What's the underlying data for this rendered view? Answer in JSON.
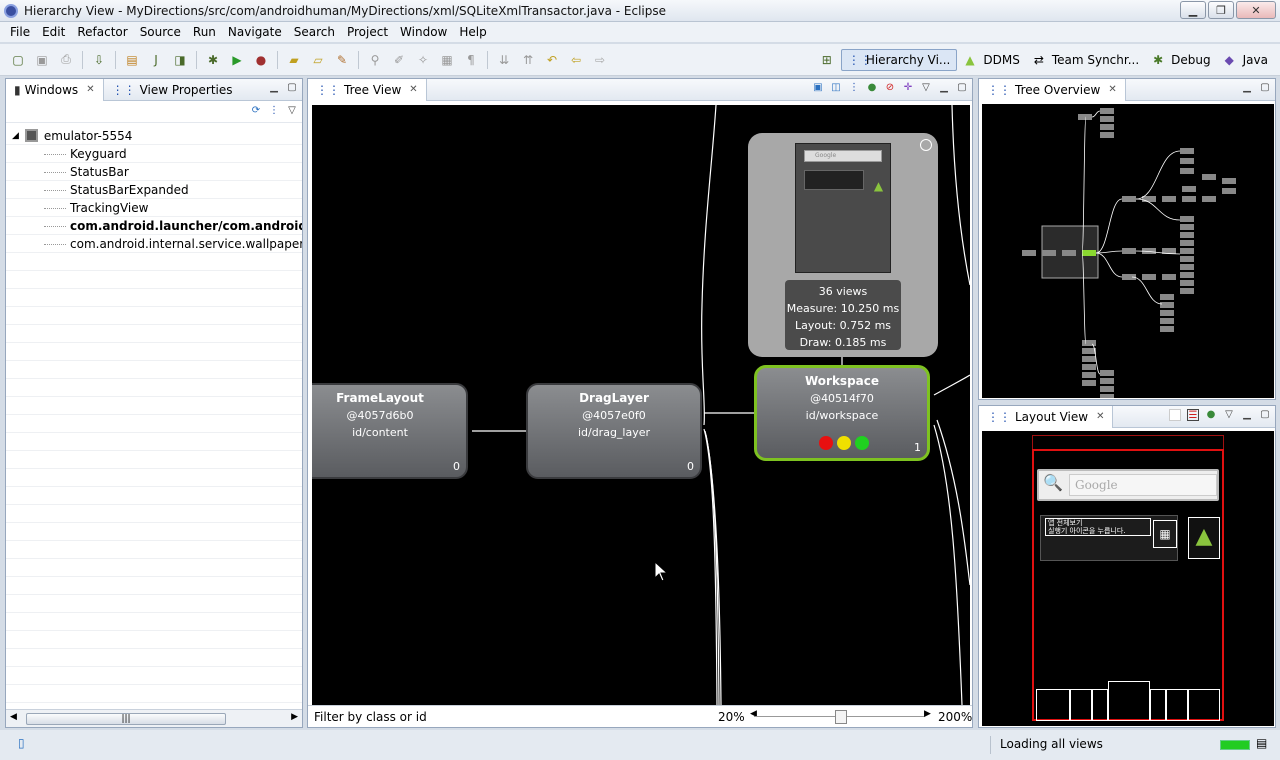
{
  "window": {
    "title": "Hierarchy View - MyDirections/src/com/androidhuman/MyDirections/xml/SQLiteXmlTransactor.java - Eclipse"
  },
  "menu": [
    "File",
    "Edit",
    "Refactor",
    "Source",
    "Run",
    "Navigate",
    "Search",
    "Project",
    "Window",
    "Help"
  ],
  "perspectives": [
    {
      "label": "Hierarchy Vi...",
      "icon": "hierarchy-icon",
      "active": true
    },
    {
      "label": "DDMS",
      "icon": "android-icon",
      "active": false
    },
    {
      "label": "Team Synchr...",
      "icon": "team-sync-icon",
      "active": false
    },
    {
      "label": "Debug",
      "icon": "bug-icon",
      "active": false
    },
    {
      "label": "Java",
      "icon": "java-icon",
      "active": false
    }
  ],
  "windows_panel": {
    "tabs": [
      "Windows",
      "View Properties"
    ],
    "device": "emulator-5554",
    "windows": [
      {
        "label": "Keyguard",
        "bold": false
      },
      {
        "label": "StatusBar",
        "bold": false
      },
      {
        "label": "StatusBarExpanded",
        "bold": false
      },
      {
        "label": "TrackingView",
        "bold": false
      },
      {
        "label": "com.android.launcher/com.android.launc",
        "bold": true
      },
      {
        "label": "com.android.internal.service.wallpaper.Imag",
        "bold": false
      }
    ],
    "scroll_thumb": "|||"
  },
  "tree_view": {
    "tab": "Tree View",
    "nodes": [
      {
        "name": "FrameLayout",
        "address": "@4057d6b0",
        "id": "id/content",
        "count": "0"
      },
      {
        "name": "DragLayer",
        "address": "@4057e0f0",
        "id": "id/drag_layer",
        "count": "0"
      },
      {
        "name": "Workspace",
        "address": "@40514f70",
        "id": "id/workspace",
        "count": "1"
      }
    ],
    "popup": {
      "views": "36 views",
      "measure": "Measure: 10.250 ms",
      "layout": "Layout: 0.752 ms",
      "draw": "Draw: 0.185 ms"
    },
    "filter_label": "Filter by class or id:",
    "zoom_min": "20%",
    "zoom_max": "200%",
    "zoom_level": 0.5
  },
  "tree_overview": {
    "tab": "Tree Overview"
  },
  "layout_view": {
    "tab": "Layout View",
    "search_placeholder": "Google",
    "notice_line1": "앱 전체보기",
    "notice_line2": "실행기 아이콘을 누릅니다."
  },
  "status": {
    "text": "Loading all views"
  },
  "colors": {
    "accent": "#7ec221",
    "light_red": "#e81010",
    "light_yellow": "#f0e000",
    "light_green": "#20d020",
    "layout_outline": "#e01010"
  }
}
